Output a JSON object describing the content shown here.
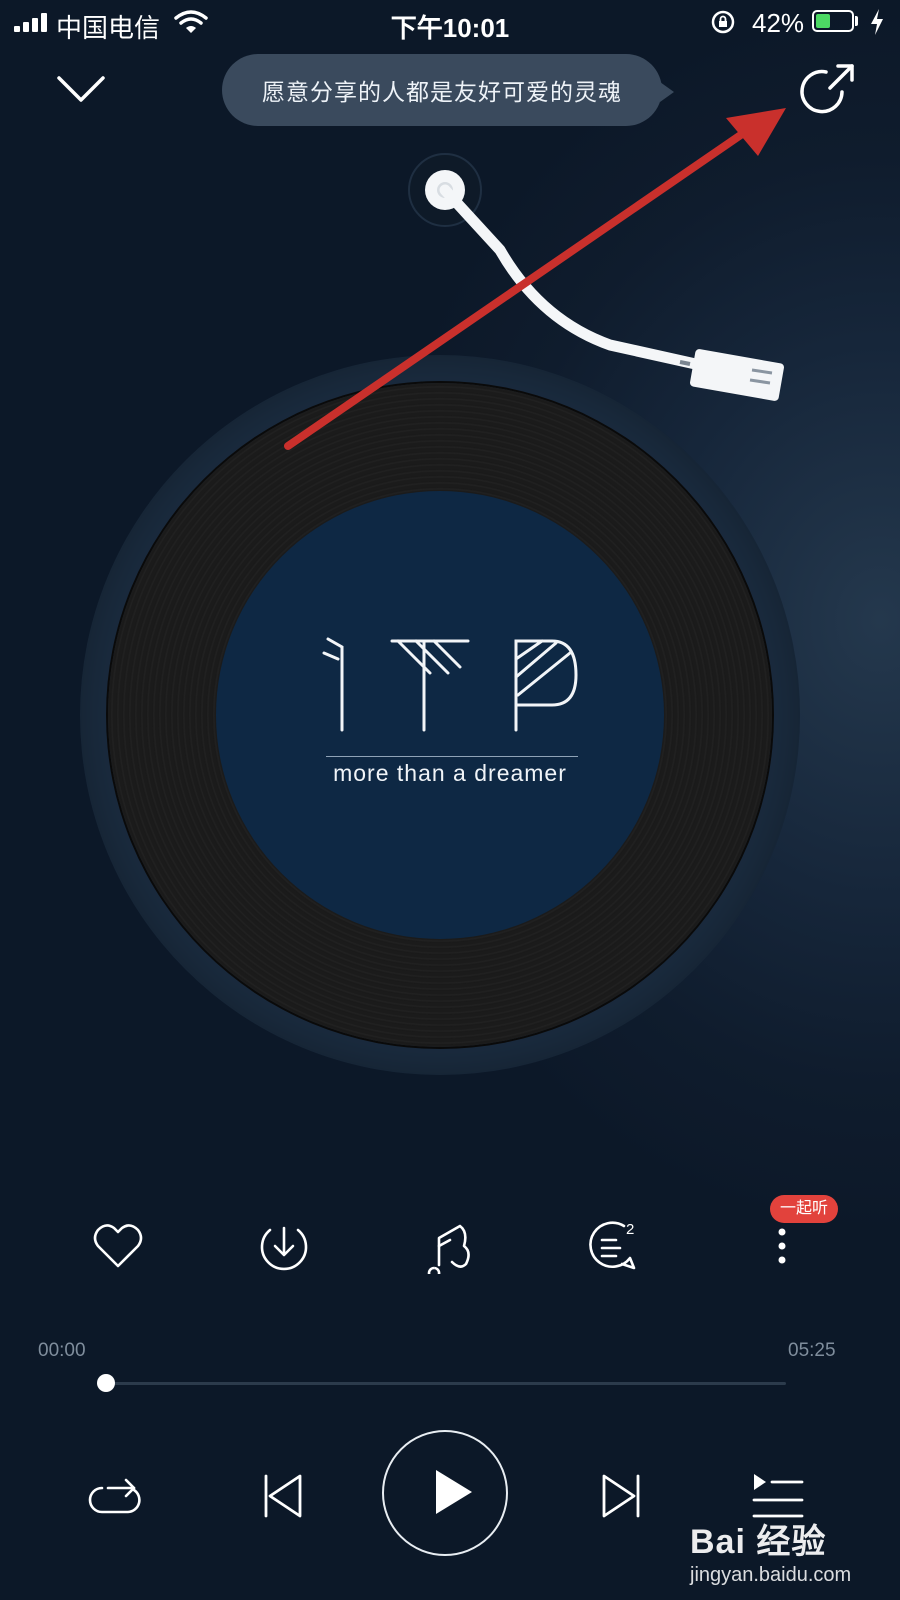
{
  "status_bar": {
    "carrier": "中国电信",
    "time": "下午10:01",
    "battery_pct": "42%",
    "battery_level": 0.42,
    "icons": [
      "signal-icon",
      "wifi-icon",
      "rotation-lock-icon",
      "battery-icon",
      "charging-bolt-icon"
    ]
  },
  "header": {
    "share_tip": "愿意分享的人都是友好可爱的灵魂",
    "icons": [
      "chevron-down-icon",
      "share-icon"
    ]
  },
  "album": {
    "logo_text": "ITP",
    "tagline": "more than a dreamer"
  },
  "actions": {
    "icons": [
      "heart-icon",
      "download-icon",
      "sound-effect-icon",
      "comment-icon",
      "more-icon"
    ],
    "comment_count": "2",
    "listen_together_badge": "一起听"
  },
  "progress": {
    "current_time": "00:00",
    "total_time": "05:25",
    "fraction": 0.0
  },
  "controls": {
    "icons": [
      "repeat-icon",
      "previous-icon",
      "play-icon",
      "next-icon",
      "playlist-icon"
    ]
  },
  "watermark": {
    "brand": "Bai 经验",
    "url": "jingyan.baidu.com"
  },
  "colors": {
    "annotation_arrow": "#c9302c",
    "badge": "#e2423c",
    "battery_fill": "#4cd964"
  }
}
